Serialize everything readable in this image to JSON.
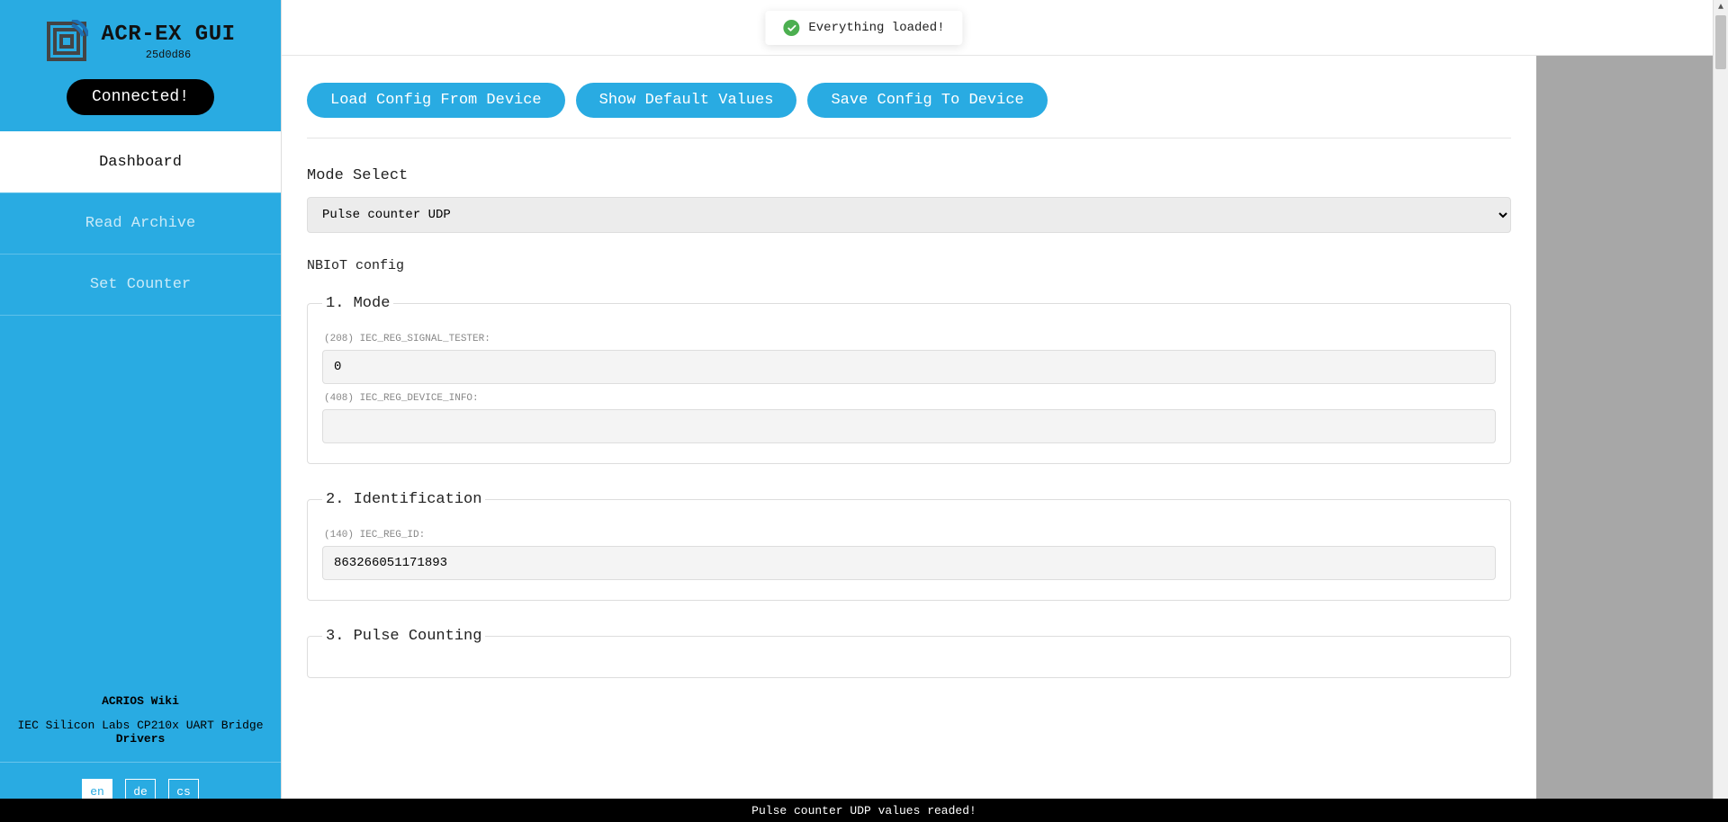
{
  "brand": {
    "title": "ACR-EX GUI",
    "version": "25d0d86"
  },
  "connection": {
    "label": "Connected!"
  },
  "nav": {
    "items": [
      {
        "id": "dashboard",
        "label": "Dashboard",
        "active": true
      },
      {
        "id": "read-archive",
        "label": "Read Archive",
        "active": false
      },
      {
        "id": "set-counter",
        "label": "Set Counter",
        "active": false
      }
    ]
  },
  "sidebar_links": {
    "wiki": "ACRIOS Wiki",
    "drivers_prefix": "IEC Silicon Labs CP210x UART Bridge ",
    "drivers_bold": "Drivers"
  },
  "lang": {
    "options": [
      "en",
      "de",
      "cs"
    ],
    "active": "en"
  },
  "toast": {
    "message": "Everything loaded!"
  },
  "actions": {
    "load": "Load Config From Device",
    "defaults": "Show Default Values",
    "save": "Save Config To Device"
  },
  "mode_select": {
    "label": "Mode Select",
    "value": "Pulse counter UDP"
  },
  "config_section": {
    "title": "NBIoT config"
  },
  "groups": {
    "mode": {
      "legend": "1. Mode",
      "fields": [
        {
          "label": "(208) IEC_REG_SIGNAL_TESTER:",
          "value": "0"
        },
        {
          "label": "(408) IEC_REG_DEVICE_INFO:",
          "value": ""
        }
      ]
    },
    "identification": {
      "legend": "2. Identification",
      "fields": [
        {
          "label": "(140) IEC_REG_ID:",
          "value": "863266051171893"
        }
      ]
    },
    "pulse": {
      "legend": "3. Pulse Counting"
    }
  },
  "footer": {
    "message": "Pulse counter UDP values readed!"
  }
}
